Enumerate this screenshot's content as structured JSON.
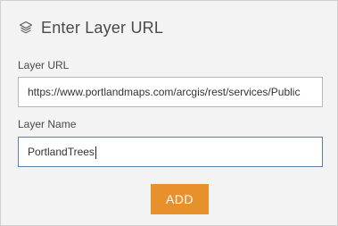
{
  "header": {
    "title": "Enter Layer URL",
    "icon": "layers-icon"
  },
  "form": {
    "url_label": "Layer URL",
    "url_value": "https://www.portlandmaps.com/arcgis/rest/services/Public",
    "name_label": "Layer Name",
    "name_value": "PortlandTrees",
    "add_label": "ADD"
  },
  "colors": {
    "accent": "#e8902c",
    "focus_border": "#5b7fa6",
    "background": "#f3f3f3"
  }
}
